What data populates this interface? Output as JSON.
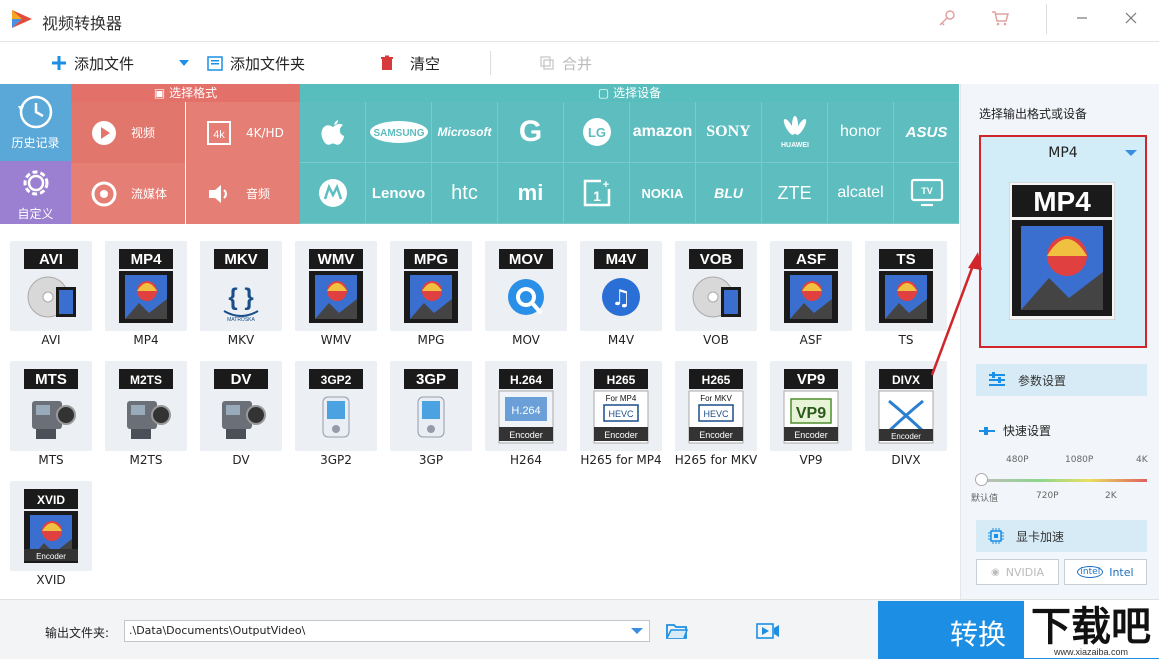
{
  "app": {
    "title": "视频转换器"
  },
  "toolbar": {
    "add_file": "添加文件",
    "add_folder": "添加文件夹",
    "clear": "清空",
    "merge": "合并"
  },
  "sidebar": {
    "history": "历史记录",
    "custom": "自定义"
  },
  "categories": {
    "format_header": "选择格式",
    "device_header": "选择设备",
    "video": "视频",
    "hd": "4K/HD",
    "streaming": "流媒体",
    "audio": "音频"
  },
  "brands": [
    "apple",
    "SAMSUNG",
    "Microsoft",
    "G",
    "LG",
    "amazon",
    "SONY",
    "HUAWEI",
    "honor",
    "ASUS",
    "motorola",
    "Lenovo",
    "htc",
    "mi",
    "OnePlus",
    "NOKIA",
    "BLU",
    "ZTE",
    "alcatel",
    "TV"
  ],
  "formats": [
    {
      "badge": "AVI",
      "name": "AVI",
      "type": "disc"
    },
    {
      "badge": "MP4",
      "name": "MP4",
      "type": "film"
    },
    {
      "badge": "MKV",
      "name": "MKV",
      "type": "mkv"
    },
    {
      "badge": "WMV",
      "name": "WMV",
      "type": "film"
    },
    {
      "badge": "MPG",
      "name": "MPG",
      "type": "film"
    },
    {
      "badge": "MOV",
      "name": "MOV",
      "type": "quicktime"
    },
    {
      "badge": "M4V",
      "name": "M4V",
      "type": "itunes"
    },
    {
      "badge": "VOB",
      "name": "VOB",
      "type": "disc"
    },
    {
      "badge": "ASF",
      "name": "ASF",
      "type": "film"
    },
    {
      "badge": "TS",
      "name": "TS",
      "type": "film"
    },
    {
      "badge": "MTS",
      "name": "MTS",
      "type": "camera"
    },
    {
      "badge": "M2TS",
      "name": "M2TS",
      "type": "camera"
    },
    {
      "badge": "DV",
      "name": "DV",
      "type": "camera"
    },
    {
      "badge": "3GP2",
      "name": "3GP2",
      "type": "phone"
    },
    {
      "badge": "3GP",
      "name": "3GP",
      "type": "phone"
    },
    {
      "badge": "H.264",
      "name": "H264",
      "type": "h264",
      "footer": "Encoder",
      "inner": "H.264"
    },
    {
      "badge": "H265",
      "name": "H265 for MP4",
      "type": "hevc",
      "sub": "For MP4",
      "inner": "HEVC",
      "footer": "Encoder"
    },
    {
      "badge": "H265",
      "name": "H265 for MKV",
      "type": "hevc",
      "sub": "For MKV",
      "inner": "HEVC",
      "footer": "Encoder"
    },
    {
      "badge": "VP9",
      "name": "VP9",
      "type": "vp9",
      "inner": "VP9",
      "footer": "Encoder"
    },
    {
      "badge": "DIVX",
      "name": "DIVX",
      "type": "divx",
      "footer": "Encoder"
    },
    {
      "badge": "XVID",
      "name": "XVID",
      "type": "xvid",
      "footer": "Encoder"
    }
  ],
  "right_panel": {
    "title": "选择输出格式或设备",
    "selected_format": "MP4",
    "param_settings": "参数设置",
    "quick_settings": "快速设置",
    "quality_top": [
      "480P",
      "1080P",
      "4K"
    ],
    "quality_bottom": [
      "默认值",
      "720P",
      "2K"
    ],
    "quality_level": 0,
    "gpu_accel": "显卡加速",
    "nvidia": "NVIDIA",
    "intel": "Intel"
  },
  "bottom": {
    "output_label": "输出文件夹:",
    "output_path": ".\\Data\\Documents\\OutputVideo\\",
    "convert": "转换"
  },
  "watermark": {
    "brand": "下载吧",
    "site": "www.xiazaiba.com"
  },
  "colors": {
    "accent": "#1c8fe4",
    "format_bg": "#e57e74",
    "device_bg": "#5ebdbf",
    "highlight": "#d0262b"
  }
}
